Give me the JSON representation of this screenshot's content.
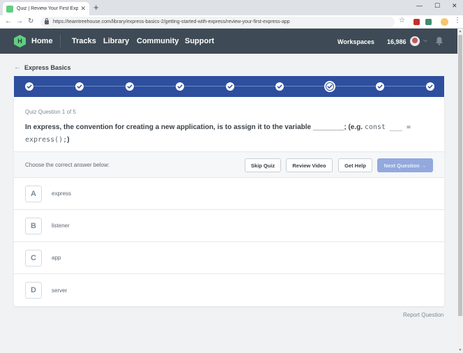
{
  "browser": {
    "tab_title": "Quiz | Review Your First Express",
    "tab_close": "✕",
    "new_tab": "+",
    "url": "https://teamtreehouse.com/library/express-basics-2/getting-started-with-express/review-your-first-express-app",
    "window_minimize": "—",
    "window_maximize": "☐",
    "window_close": "✕"
  },
  "header": {
    "logo_glyph": "H",
    "home": "Home",
    "nav": [
      "Tracks",
      "Library",
      "Community",
      "Support"
    ],
    "workspaces": "Workspaces",
    "points": "16,986"
  },
  "breadcrumb": {
    "label": "Express Basics"
  },
  "progress": {
    "total_steps": 9,
    "current_step": 7
  },
  "question": {
    "meta": "Quiz Question 1 of 5",
    "text_before": "In express, the convention for creating a new application, is to assign it to the variable ________; (e.g. ",
    "code_1": "const ___ =",
    "code_2": "express();",
    "text_after": ")"
  },
  "toolbar": {
    "prompt": "Choose the correct answer below:",
    "skip": "Skip Quiz",
    "review": "Review Video",
    "help": "Get Help",
    "next": "Next Question",
    "next_arrow": "→"
  },
  "answers": [
    {
      "letter": "A",
      "text": "express"
    },
    {
      "letter": "B",
      "text": "listener"
    },
    {
      "letter": "C",
      "text": "app"
    },
    {
      "letter": "D",
      "text": "server"
    }
  ],
  "footer": {
    "report": "Report Question"
  },
  "colors": {
    "header_bg": "#3e4a55",
    "progress_bg": "#2d4f9e",
    "brand_green": "#5fcf80",
    "next_button": "#93a9dd"
  }
}
